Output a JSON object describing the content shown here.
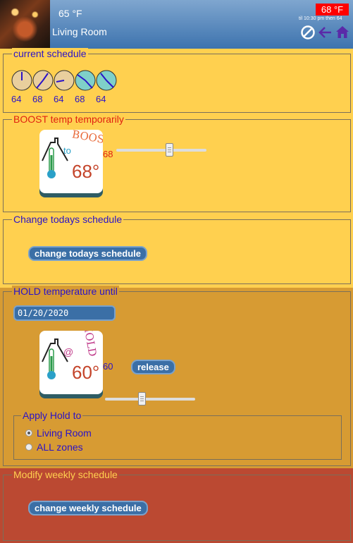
{
  "header": {
    "current_temp": "65 °F",
    "room_name": "Living Room",
    "setpoint_badge": "68 °F",
    "schedule_note": "til 10:30 pm then 64",
    "icons": [
      "cancel-icon",
      "back-arrow-icon",
      "home-icon"
    ]
  },
  "current_schedule": {
    "legend": "current schedule",
    "values": [
      "64",
      "68",
      "64",
      "68",
      "64"
    ]
  },
  "boost": {
    "legend": "BOOST temp temporarily",
    "tile_word": "BOOST",
    "tile_sub": "to",
    "tile_temp": "68°",
    "value": "68",
    "slider_level": 0.6
  },
  "change_today": {
    "legend": "Change todays schedule",
    "button": "change todays schedule"
  },
  "hold": {
    "legend": "HOLD temperature until",
    "date": "01/20/2020",
    "tile_word": "HOLD",
    "tile_sub": "@",
    "tile_temp": "60°",
    "value": "60",
    "release_button": "release",
    "slider_level": 0.4,
    "apply_legend": "Apply Hold to",
    "options": [
      "Living Room",
      "ALL zones"
    ],
    "selected": "Living Room"
  },
  "weekly": {
    "legend": "Modify weekly schedule",
    "button": "change weekly schedule"
  },
  "colors": {
    "header_blue": "#3d73ae",
    "panel_yellow": "#ffd04f",
    "panel_orange": "#d79b33",
    "panel_red": "#bb4932",
    "badge_red": "#ff0000",
    "text_blue": "#2a12c8"
  }
}
